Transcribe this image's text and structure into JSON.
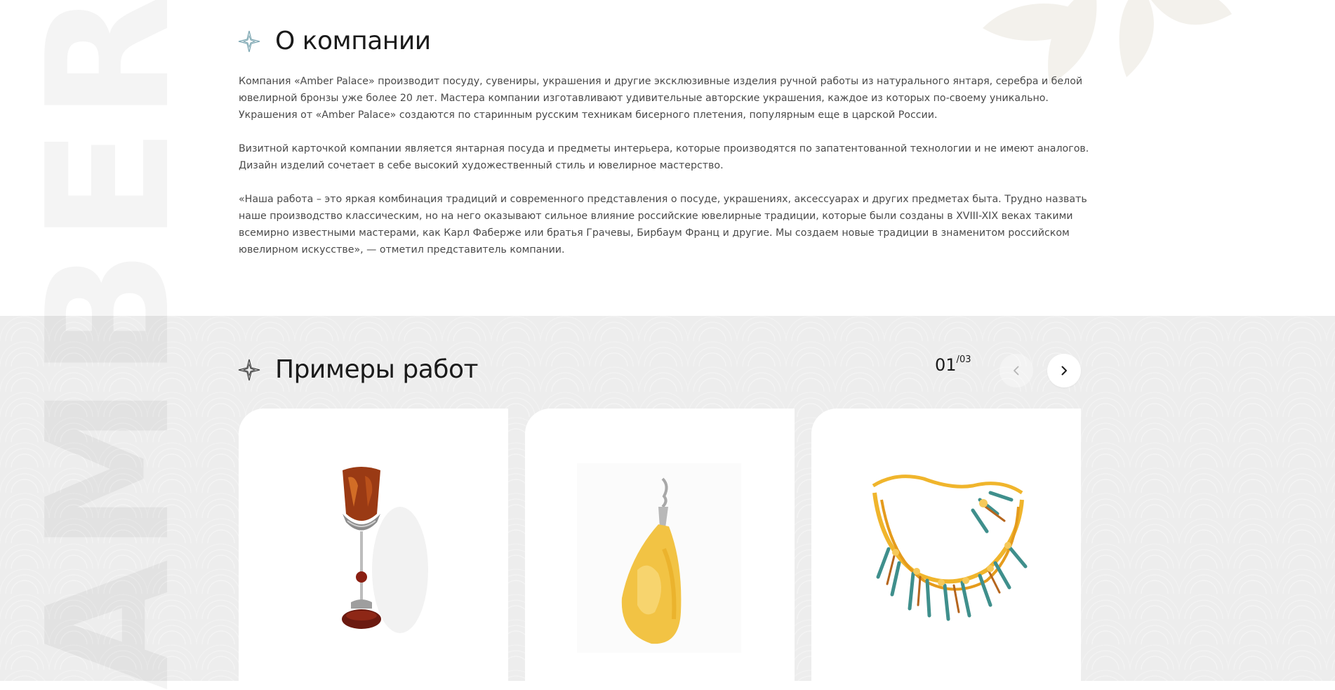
{
  "background": {
    "watermark": "AMBER",
    "colors": {
      "gray_band": "#ededed",
      "accent_brown": "#8a2a14",
      "amber": "#f0b52c"
    }
  },
  "about": {
    "title": "О компании",
    "paragraphs": [
      "Компания «Amber Palace» производит посуду, сувениры, украшения и другие эксклюзивные изделия ручной работы из натурального янтаря, серебра и белой ювелирной бронзы уже более 20 лет. Мастера компании изготавливают удивительные авторские украшения, каждое из которых по-своему уникально. Украшения от «Amber Palace» создаются по старинным русским техникам бисерного плетения, популярным еще в царской России.",
      "Визитной карточкой компании является янтарная посуда и предметы интерьера, которые производятся по запатентованной технологии и не имеют аналогов. Дизайн изделий сочетает в себе высокий художественный стиль и ювелирное мастерство.",
      "«Наша работа – это яркая комбинация традиций и современного представления о посуде, украшениях, аксессуарах и других предметах быта. Трудно назвать наше производство классическим, но на него оказывают сильное влияние российские ювелирные традиции, которые были созданы в XVIII-XIX веках такими всемирно известными мастерами, как Карл Фаберже или братья Грачевы, Бирбаум Франц и другие. Мы создаем новые традиции в знаменитом российском ювелирном искусстве», — отметил представитель компании."
    ]
  },
  "works": {
    "title": "Примеры работ",
    "counter": {
      "current": "01",
      "separator": "/",
      "total": "03"
    },
    "prev_icon": "chevron-left-icon",
    "next_icon": "chevron-right-icon",
    "items": [
      {
        "image": "amber-goblet"
      },
      {
        "image": "amber-pendant"
      },
      {
        "image": "amber-beaded-necklace"
      }
    ]
  }
}
